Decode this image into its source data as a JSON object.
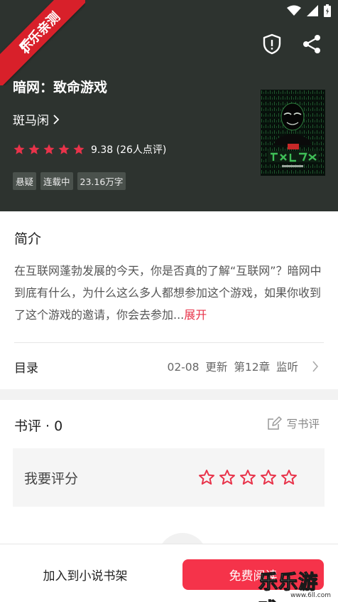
{
  "watermark_ribbon": "乐乐亲测",
  "book": {
    "title": "暗网：致命游戏",
    "author": "斑马闲",
    "rating": 9.38,
    "rating_text": "9.38 (26人点评)",
    "stars_filled": 5,
    "tags": [
      "悬疑",
      "连载中",
      "23.16万字"
    ]
  },
  "intro": {
    "heading": "简介",
    "text": "在互联网蓬勃发展的今天，你是否真的了解“互联网”？暗网中到底有什么，为什么这么多人都想参加这个游戏，如果你收到了这个游戏的邀请，你会去参加...",
    "more": "展开"
  },
  "toc": {
    "label": "目录",
    "latest": "02-08  更新  第12章 监听"
  },
  "reviews": {
    "heading": "书评 · 0",
    "write_label": "写书评",
    "rate_label": "我要评分",
    "rate_stars": 5
  },
  "bottom": {
    "add_shelf": "加入到小说书架",
    "read_free": "免费阅读"
  },
  "brand_watermark": {
    "text": "乐乐游戏",
    "url": "www.6ll.com"
  },
  "colors": {
    "header_bg": "#2d332f",
    "accent_red": "#f5334a",
    "star_red": "#e8334a",
    "link_red": "#e8334a"
  },
  "icons": [
    "back-arrow-icon",
    "shield-icon",
    "share-icon",
    "wifi-icon",
    "signal-icon",
    "battery-icon",
    "chevron-right-icon",
    "edit-icon",
    "star-icon"
  ]
}
